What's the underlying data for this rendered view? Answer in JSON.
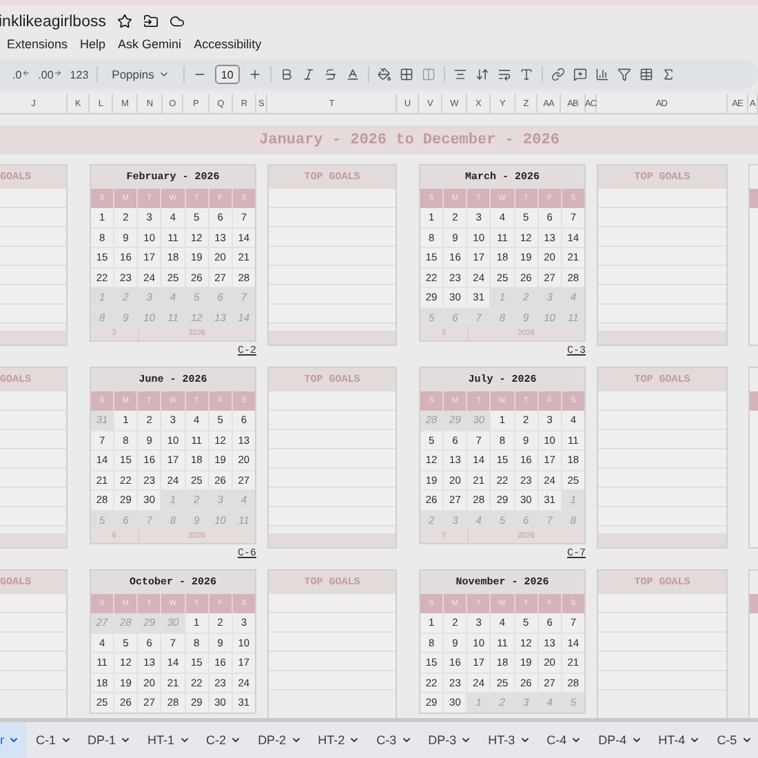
{
  "doc_title": "inklikeagirlboss",
  "menu": [
    "Extensions",
    "Help",
    "Ask Gemini",
    "Accessibility"
  ],
  "toolbar": {
    "decrease_decimal": ".0",
    "increase_decimal": ".00",
    "number_format": "123",
    "font": "Poppins",
    "font_size": "10"
  },
  "column_headers": [
    "J",
    "K",
    "L",
    "M",
    "N",
    "O",
    "P",
    "Q",
    "R",
    "S",
    "T",
    "U",
    "V",
    "W",
    "X",
    "Y",
    "Z",
    "AA",
    "AB",
    "AC",
    "AD",
    "AE",
    "A"
  ],
  "banner": "January - 2026 to December - 2026",
  "rows": [
    {
      "items": [
        {
          "kind": "goals",
          "header": "GOALS",
          "cut": true
        },
        {
          "kind": "calendar",
          "title": "February - 2026",
          "weekdays": [
            "S",
            "M",
            "T",
            "W",
            "T",
            "F",
            "S"
          ],
          "weeks": [
            [
              {
                "n": "1",
                "outside": false
              },
              {
                "n": "2",
                "outside": false
              },
              {
                "n": "3",
                "outside": false
              },
              {
                "n": "4",
                "outside": false
              },
              {
                "n": "5",
                "outside": false
              },
              {
                "n": "6",
                "outside": false
              },
              {
                "n": "7",
                "outside": false
              }
            ],
            [
              {
                "n": "8",
                "outside": false
              },
              {
                "n": "9",
                "outside": false
              },
              {
                "n": "10",
                "outside": false
              },
              {
                "n": "11",
                "outside": false
              },
              {
                "n": "12",
                "outside": false
              },
              {
                "n": "13",
                "outside": false
              },
              {
                "n": "14",
                "outside": false
              }
            ],
            [
              {
                "n": "15",
                "outside": false
              },
              {
                "n": "16",
                "outside": false
              },
              {
                "n": "17",
                "outside": false
              },
              {
                "n": "18",
                "outside": false
              },
              {
                "n": "19",
                "outside": false
              },
              {
                "n": "20",
                "outside": false
              },
              {
                "n": "21",
                "outside": false
              }
            ],
            [
              {
                "n": "22",
                "outside": false
              },
              {
                "n": "23",
                "outside": false
              },
              {
                "n": "24",
                "outside": false
              },
              {
                "n": "25",
                "outside": false
              },
              {
                "n": "26",
                "outside": false
              },
              {
                "n": "27",
                "outside": false
              },
              {
                "n": "28",
                "outside": false
              }
            ],
            [
              {
                "n": "1",
                "outside": true
              },
              {
                "n": "2",
                "outside": true
              },
              {
                "n": "3",
                "outside": true
              },
              {
                "n": "4",
                "outside": true
              },
              {
                "n": "5",
                "outside": true
              },
              {
                "n": "6",
                "outside": true
              },
              {
                "n": "7",
                "outside": true
              }
            ],
            [
              {
                "n": "8",
                "outside": true
              },
              {
                "n": "9",
                "outside": true
              },
              {
                "n": "10",
                "outside": true
              },
              {
                "n": "11",
                "outside": true
              },
              {
                "n": "12",
                "outside": true
              },
              {
                "n": "13",
                "outside": true
              },
              {
                "n": "14",
                "outside": true
              }
            ]
          ],
          "footer": {
            "month": "2",
            "year": "2026"
          },
          "link": "C-2"
        },
        {
          "kind": "goals",
          "header": "TOP GOALS",
          "cut": false
        },
        {
          "kind": "calendar",
          "title": "March - 2026",
          "weekdays": [
            "S",
            "M",
            "T",
            "W",
            "T",
            "F",
            "S"
          ],
          "weeks": [
            [
              {
                "n": "1",
                "outside": false
              },
              {
                "n": "2",
                "outside": false
              },
              {
                "n": "3",
                "outside": false
              },
              {
                "n": "4",
                "outside": false
              },
              {
                "n": "5",
                "outside": false
              },
              {
                "n": "6",
                "outside": false
              },
              {
                "n": "7",
                "outside": false
              }
            ],
            [
              {
                "n": "8",
                "outside": false
              },
              {
                "n": "9",
                "outside": false
              },
              {
                "n": "10",
                "outside": false
              },
              {
                "n": "11",
                "outside": false
              },
              {
                "n": "12",
                "outside": false
              },
              {
                "n": "13",
                "outside": false
              },
              {
                "n": "14",
                "outside": false
              }
            ],
            [
              {
                "n": "15",
                "outside": false
              },
              {
                "n": "16",
                "outside": false
              },
              {
                "n": "17",
                "outside": false
              },
              {
                "n": "18",
                "outside": false
              },
              {
                "n": "19",
                "outside": false
              },
              {
                "n": "20",
                "outside": false
              },
              {
                "n": "21",
                "outside": false
              }
            ],
            [
              {
                "n": "22",
                "outside": false
              },
              {
                "n": "23",
                "outside": false
              },
              {
                "n": "24",
                "outside": false
              },
              {
                "n": "25",
                "outside": false
              },
              {
                "n": "26",
                "outside": false
              },
              {
                "n": "27",
                "outside": false
              },
              {
                "n": "28",
                "outside": false
              }
            ],
            [
              {
                "n": "29",
                "outside": false
              },
              {
                "n": "30",
                "outside": false
              },
              {
                "n": "31",
                "outside": false
              },
              {
                "n": "1",
                "outside": true
              },
              {
                "n": "2",
                "outside": true
              },
              {
                "n": "3",
                "outside": true
              },
              {
                "n": "4",
                "outside": true
              }
            ],
            [
              {
                "n": "5",
                "outside": true
              },
              {
                "n": "6",
                "outside": true
              },
              {
                "n": "7",
                "outside": true
              },
              {
                "n": "8",
                "outside": true
              },
              {
                "n": "9",
                "outside": true
              },
              {
                "n": "10",
                "outside": true
              },
              {
                "n": "11",
                "outside": true
              }
            ]
          ],
          "footer": {
            "month": "3",
            "year": "2026"
          },
          "link": "C-3"
        },
        {
          "kind": "goals",
          "header": "TOP GOALS",
          "cut": false
        },
        {
          "kind": "edge"
        }
      ]
    },
    {
      "items": [
        {
          "kind": "goals",
          "header": "GOALS",
          "cut": true
        },
        {
          "kind": "calendar",
          "title": "June - 2026",
          "weekdays": [
            "S",
            "M",
            "T",
            "W",
            "T",
            "F",
            "S"
          ],
          "weeks": [
            [
              {
                "n": "31",
                "outside": true
              },
              {
                "n": "1",
                "outside": false
              },
              {
                "n": "2",
                "outside": false
              },
              {
                "n": "3",
                "outside": false
              },
              {
                "n": "4",
                "outside": false
              },
              {
                "n": "5",
                "outside": false
              },
              {
                "n": "6",
                "outside": false
              }
            ],
            [
              {
                "n": "7",
                "outside": false
              },
              {
                "n": "8",
                "outside": false
              },
              {
                "n": "9",
                "outside": false
              },
              {
                "n": "10",
                "outside": false
              },
              {
                "n": "11",
                "outside": false
              },
              {
                "n": "12",
                "outside": false
              },
              {
                "n": "13",
                "outside": false
              }
            ],
            [
              {
                "n": "14",
                "outside": false
              },
              {
                "n": "15",
                "outside": false
              },
              {
                "n": "16",
                "outside": false
              },
              {
                "n": "17",
                "outside": false
              },
              {
                "n": "18",
                "outside": false
              },
              {
                "n": "19",
                "outside": false
              },
              {
                "n": "20",
                "outside": false
              }
            ],
            [
              {
                "n": "21",
                "outside": false
              },
              {
                "n": "22",
                "outside": false
              },
              {
                "n": "23",
                "outside": false
              },
              {
                "n": "24",
                "outside": false
              },
              {
                "n": "25",
                "outside": false
              },
              {
                "n": "26",
                "outside": false
              },
              {
                "n": "27",
                "outside": false
              }
            ],
            [
              {
                "n": "28",
                "outside": false
              },
              {
                "n": "29",
                "outside": false
              },
              {
                "n": "30",
                "outside": false
              },
              {
                "n": "1",
                "outside": true
              },
              {
                "n": "2",
                "outside": true
              },
              {
                "n": "3",
                "outside": true
              },
              {
                "n": "4",
                "outside": true
              }
            ],
            [
              {
                "n": "5",
                "outside": true
              },
              {
                "n": "6",
                "outside": true
              },
              {
                "n": "7",
                "outside": true
              },
              {
                "n": "8",
                "outside": true
              },
              {
                "n": "9",
                "outside": true
              },
              {
                "n": "10",
                "outside": true
              },
              {
                "n": "11",
                "outside": true
              }
            ]
          ],
          "footer": {
            "month": "6",
            "year": "2026"
          },
          "link": "C-6"
        },
        {
          "kind": "goals",
          "header": "TOP GOALS",
          "cut": false
        },
        {
          "kind": "calendar",
          "title": "July - 2026",
          "weekdays": [
            "S",
            "M",
            "T",
            "W",
            "T",
            "F",
            "S"
          ],
          "weeks": [
            [
              {
                "n": "28",
                "outside": true
              },
              {
                "n": "29",
                "outside": true
              },
              {
                "n": "30",
                "outside": true
              },
              {
                "n": "1",
                "outside": false
              },
              {
                "n": "2",
                "outside": false
              },
              {
                "n": "3",
                "outside": false
              },
              {
                "n": "4",
                "outside": false
              }
            ],
            [
              {
                "n": "5",
                "outside": false
              },
              {
                "n": "6",
                "outside": false
              },
              {
                "n": "7",
                "outside": false
              },
              {
                "n": "8",
                "outside": false
              },
              {
                "n": "9",
                "outside": false
              },
              {
                "n": "10",
                "outside": false
              },
              {
                "n": "11",
                "outside": false
              }
            ],
            [
              {
                "n": "12",
                "outside": false
              },
              {
                "n": "13",
                "outside": false
              },
              {
                "n": "14",
                "outside": false
              },
              {
                "n": "15",
                "outside": false
              },
              {
                "n": "16",
                "outside": false
              },
              {
                "n": "17",
                "outside": false
              },
              {
                "n": "18",
                "outside": false
              }
            ],
            [
              {
                "n": "19",
                "outside": false
              },
              {
                "n": "20",
                "outside": false
              },
              {
                "n": "21",
                "outside": false
              },
              {
                "n": "22",
                "outside": false
              },
              {
                "n": "23",
                "outside": false
              },
              {
                "n": "24",
                "outside": false
              },
              {
                "n": "25",
                "outside": false
              }
            ],
            [
              {
                "n": "26",
                "outside": false
              },
              {
                "n": "27",
                "outside": false
              },
              {
                "n": "28",
                "outside": false
              },
              {
                "n": "29",
                "outside": false
              },
              {
                "n": "30",
                "outside": false
              },
              {
                "n": "31",
                "outside": false
              },
              {
                "n": "1",
                "outside": true
              }
            ],
            [
              {
                "n": "2",
                "outside": true
              },
              {
                "n": "3",
                "outside": true
              },
              {
                "n": "4",
                "outside": true
              },
              {
                "n": "5",
                "outside": true
              },
              {
                "n": "6",
                "outside": true
              },
              {
                "n": "7",
                "outside": true
              },
              {
                "n": "8",
                "outside": true
              }
            ]
          ],
          "footer": {
            "month": "7",
            "year": "2026"
          },
          "link": "C-7"
        },
        {
          "kind": "goals",
          "header": "TOP GOALS",
          "cut": false
        },
        {
          "kind": "edge"
        }
      ]
    },
    {
      "items": [
        {
          "kind": "goals",
          "header": "GOALS",
          "cut": true
        },
        {
          "kind": "calendar",
          "title": "October - 2026",
          "weekdays": [
            "S",
            "M",
            "T",
            "W",
            "T",
            "F",
            "S"
          ],
          "weeks": [
            [
              {
                "n": "27",
                "outside": true
              },
              {
                "n": "28",
                "outside": true
              },
              {
                "n": "29",
                "outside": true
              },
              {
                "n": "30",
                "outside": true
              },
              {
                "n": "1",
                "outside": false
              },
              {
                "n": "2",
                "outside": false
              },
              {
                "n": "3",
                "outside": false
              }
            ],
            [
              {
                "n": "4",
                "outside": false
              },
              {
                "n": "5",
                "outside": false
              },
              {
                "n": "6",
                "outside": false
              },
              {
                "n": "7",
                "outside": false
              },
              {
                "n": "8",
                "outside": false
              },
              {
                "n": "9",
                "outside": false
              },
              {
                "n": "10",
                "outside": false
              }
            ],
            [
              {
                "n": "11",
                "outside": false
              },
              {
                "n": "12",
                "outside": false
              },
              {
                "n": "13",
                "outside": false
              },
              {
                "n": "14",
                "outside": false
              },
              {
                "n": "15",
                "outside": false
              },
              {
                "n": "16",
                "outside": false
              },
              {
                "n": "17",
                "outside": false
              }
            ],
            [
              {
                "n": "18",
                "outside": false
              },
              {
                "n": "19",
                "outside": false
              },
              {
                "n": "20",
                "outside": false
              },
              {
                "n": "21",
                "outside": false
              },
              {
                "n": "22",
                "outside": false
              },
              {
                "n": "23",
                "outside": false
              },
              {
                "n": "24",
                "outside": false
              }
            ],
            [
              {
                "n": "25",
                "outside": false
              },
              {
                "n": "26",
                "outside": false
              },
              {
                "n": "27",
                "outside": false
              },
              {
                "n": "28",
                "outside": false
              },
              {
                "n": "29",
                "outside": false
              },
              {
                "n": "30",
                "outside": false
              },
              {
                "n": "31",
                "outside": false
              }
            ]
          ]
        },
        {
          "kind": "goals",
          "header": "TOP GOALS",
          "cut": false
        },
        {
          "kind": "calendar",
          "title": "November - 2026",
          "weekdays": [
            "S",
            "M",
            "T",
            "W",
            "T",
            "F",
            "S"
          ],
          "weeks": [
            [
              {
                "n": "1",
                "outside": false
              },
              {
                "n": "2",
                "outside": false
              },
              {
                "n": "3",
                "outside": false
              },
              {
                "n": "4",
                "outside": false
              },
              {
                "n": "5",
                "outside": false
              },
              {
                "n": "6",
                "outside": false
              },
              {
                "n": "7",
                "outside": false
              }
            ],
            [
              {
                "n": "8",
                "outside": false
              },
              {
                "n": "9",
                "outside": false
              },
              {
                "n": "10",
                "outside": false
              },
              {
                "n": "11",
                "outside": false
              },
              {
                "n": "12",
                "outside": false
              },
              {
                "n": "13",
                "outside": false
              },
              {
                "n": "14",
                "outside": false
              }
            ],
            [
              {
                "n": "15",
                "outside": false
              },
              {
                "n": "16",
                "outside": false
              },
              {
                "n": "17",
                "outside": false
              },
              {
                "n": "18",
                "outside": false
              },
              {
                "n": "19",
                "outside": false
              },
              {
                "n": "20",
                "outside": false
              },
              {
                "n": "21",
                "outside": false
              }
            ],
            [
              {
                "n": "22",
                "outside": false
              },
              {
                "n": "23",
                "outside": false
              },
              {
                "n": "24",
                "outside": false
              },
              {
                "n": "25",
                "outside": false
              },
              {
                "n": "26",
                "outside": false
              },
              {
                "n": "27",
                "outside": false
              },
              {
                "n": "28",
                "outside": false
              }
            ],
            [
              {
                "n": "29",
                "outside": false
              },
              {
                "n": "30",
                "outside": false
              },
              {
                "n": "1",
                "outside": true
              },
              {
                "n": "2",
                "outside": true
              },
              {
                "n": "3",
                "outside": true
              },
              {
                "n": "4",
                "outside": true
              },
              {
                "n": "5",
                "outside": true
              }
            ]
          ]
        },
        {
          "kind": "goals",
          "header": "TOP GOALS",
          "cut": false
        },
        {
          "kind": "edge"
        }
      ]
    }
  ],
  "sheet_tabs": [
    {
      "label": "r",
      "selected": true
    },
    {
      "label": "C-1",
      "selected": false
    },
    {
      "label": "DP-1",
      "selected": false
    },
    {
      "label": "HT-1",
      "selected": false
    },
    {
      "label": "C-2",
      "selected": false
    },
    {
      "label": "DP-2",
      "selected": false
    },
    {
      "label": "HT-2",
      "selected": false
    },
    {
      "label": "C-3",
      "selected": false
    },
    {
      "label": "DP-3",
      "selected": false
    },
    {
      "label": "HT-3",
      "selected": false
    },
    {
      "label": "C-4",
      "selected": false
    },
    {
      "label": "DP-4",
      "selected": false
    },
    {
      "label": "HT-4",
      "selected": false
    },
    {
      "label": "C-5",
      "selected": false
    }
  ]
}
